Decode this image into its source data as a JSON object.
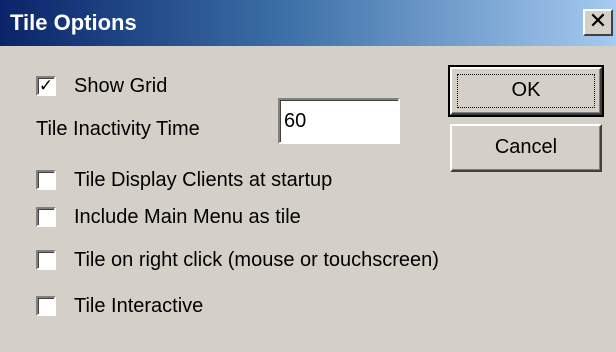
{
  "window": {
    "title": "Tile Options",
    "close_glyph": "✕"
  },
  "options": {
    "show_grid": {
      "label": "Show Grid",
      "checked": true
    },
    "tile_inactivity_time": {
      "label": "Tile Inactivity Time",
      "value": "60"
    },
    "tile_display_clients": {
      "label": "Tile Display Clients at startup",
      "checked": false
    },
    "include_main_menu": {
      "label": "Include Main Menu as tile",
      "checked": false
    },
    "tile_right_click": {
      "label": "Tile on right click (mouse or touchscreen)",
      "checked": false
    },
    "tile_interactive": {
      "label": "Tile Interactive",
      "checked": false
    }
  },
  "buttons": {
    "ok_label": "OK",
    "cancel_label": "Cancel"
  },
  "colors": {
    "face": "#d4d0c8",
    "title_start": "#0a246a",
    "title_end": "#a6caf0"
  },
  "icons": {
    "check": "checkmark-icon",
    "close": "close-icon"
  }
}
